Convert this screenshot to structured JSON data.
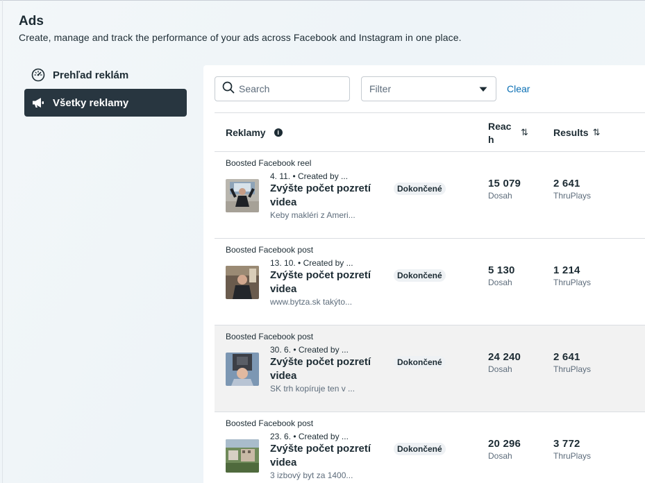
{
  "header": {
    "title": "Ads",
    "subtitle": "Create, manage and track the performance of your ads across Facebook and Instagram in one place."
  },
  "nav": {
    "items": [
      {
        "label": "Prehľad reklám",
        "icon": "dashboard-gauge-icon"
      },
      {
        "label": "Všetky reklamy",
        "icon": "megaphone-icon",
        "active": true
      }
    ]
  },
  "toolbar": {
    "search_placeholder": "Search",
    "filter_placeholder": "Filter",
    "clear_label": "Clear"
  },
  "table": {
    "columns": {
      "ads": "Reklamy",
      "reach": "Reac h",
      "results": "Results"
    },
    "rows": [
      {
        "type": "Boosted Facebook reel",
        "meta": "4. 11. • Created by ...",
        "title": "Zvýšte počet pozretí videa",
        "description": "Keby makléri z Ameri...",
        "status": "Dokončené",
        "reach_value": "15 079",
        "reach_label": "Dosah",
        "results_value": "2 641",
        "results_label": "ThruPlays"
      },
      {
        "type": "Boosted Facebook post",
        "meta": "13. 10. • Created by ...",
        "title": "Zvýšte počet pozretí videa",
        "description": "www.bytza.sk takýto...",
        "status": "Dokončené",
        "reach_value": "5 130",
        "reach_label": "Dosah",
        "results_value": "1 214",
        "results_label": "ThruPlays"
      },
      {
        "type": "Boosted Facebook post",
        "meta": "30. 6. • Created by ...",
        "title": "Zvýšte počet pozretí videa",
        "description": "SK trh kopíruje ten v ...",
        "status": "Dokončené",
        "reach_value": "24 240",
        "reach_label": "Dosah",
        "results_value": "2 641",
        "results_label": "ThruPlays"
      },
      {
        "type": "Boosted Facebook post",
        "meta": "23. 6. • Created by ...",
        "title": "Zvýšte počet pozretí videa",
        "description": "3 izbový byt za 1400...",
        "status": "Dokončené",
        "reach_value": "20 296",
        "reach_label": "Dosah",
        "results_value": "3 772",
        "results_label": "ThruPlays"
      }
    ]
  }
}
